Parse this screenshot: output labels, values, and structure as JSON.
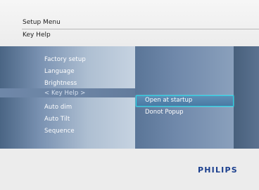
{
  "header": {
    "title": "Setup Menu",
    "subtitle": "Key Help"
  },
  "menu": {
    "items": [
      {
        "label": "Factory setup"
      },
      {
        "label": "Language"
      },
      {
        "label": "Brightness"
      },
      {
        "label": "< Key Help >",
        "selected": true
      },
      {
        "label": "Auto dim"
      },
      {
        "label": "Auto Tilt"
      },
      {
        "label": "Sequence"
      }
    ]
  },
  "submenu": {
    "items": [
      {
        "label": "Open at startup",
        "selected": true
      },
      {
        "label": "Donot Popup"
      }
    ]
  },
  "brand": {
    "logo": "PHILIPS"
  },
  "colors": {
    "brand": "#1b3f8e",
    "highlight_border": "#2ad6e8"
  }
}
